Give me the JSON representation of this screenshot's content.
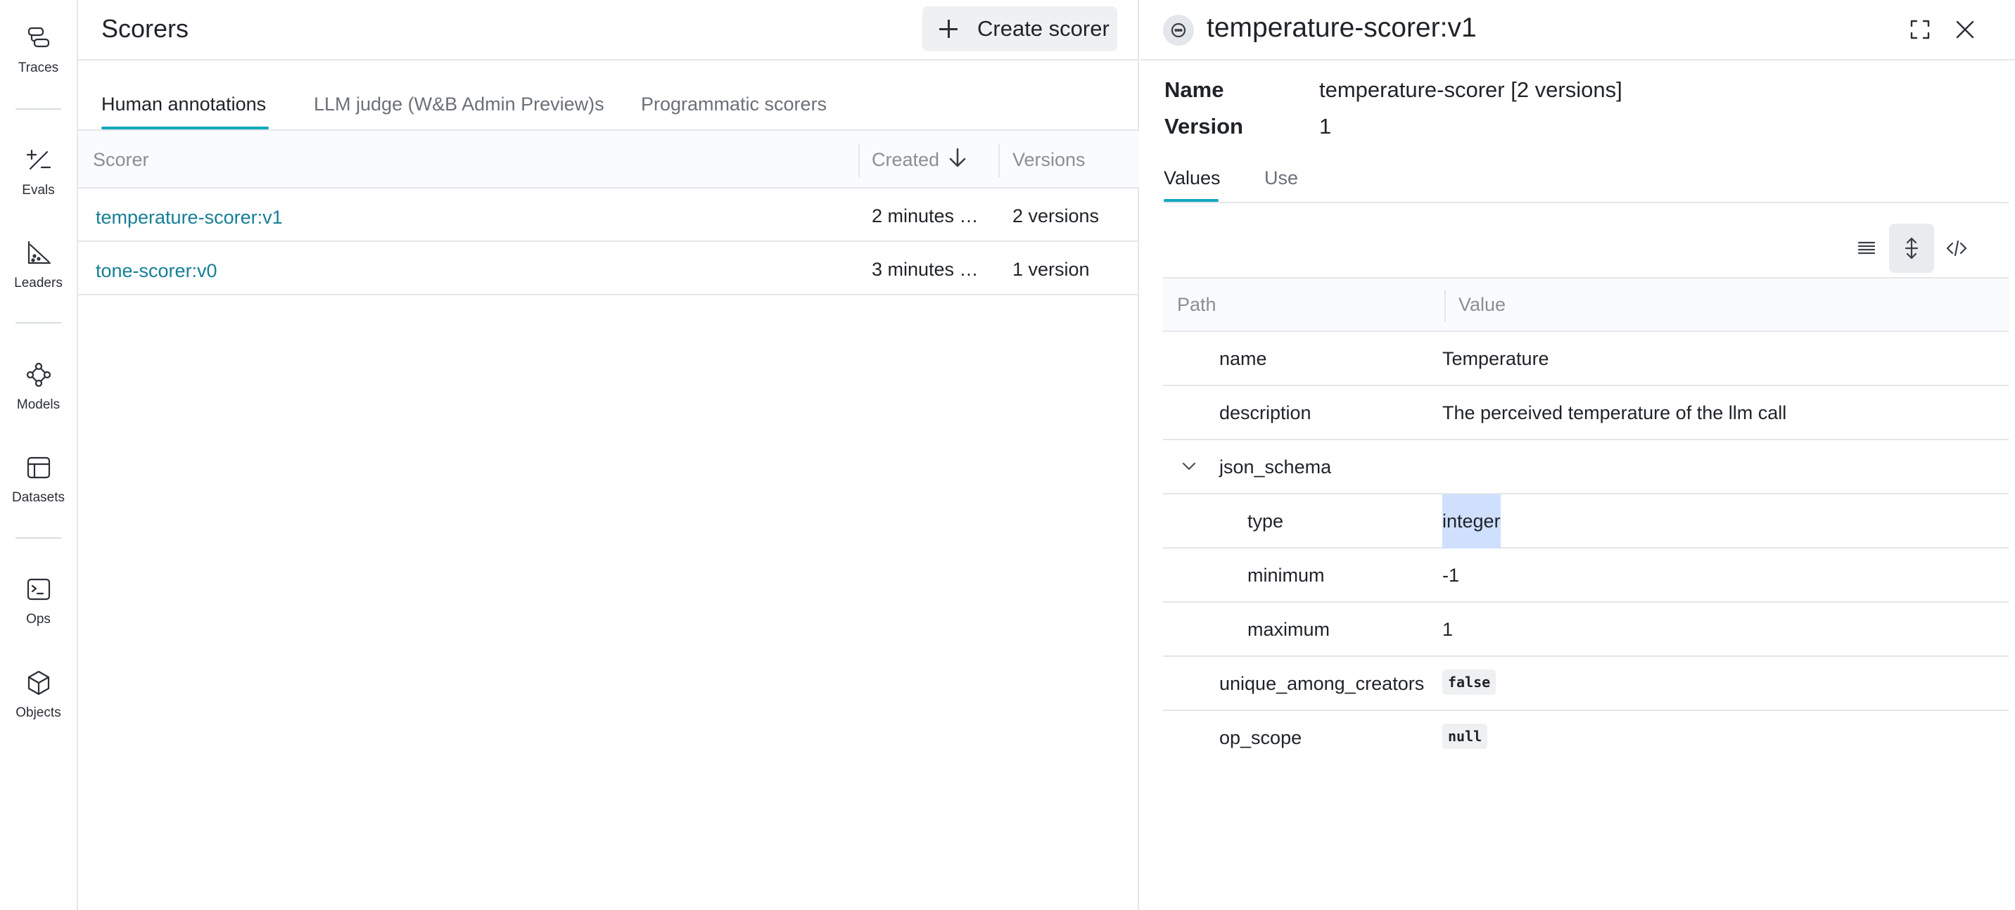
{
  "nav": {
    "items": [
      {
        "label": "Traces",
        "icon": "traces-icon"
      },
      {
        "label": "Evals",
        "icon": "evals-icon"
      },
      {
        "label": "Leaders",
        "icon": "leaders-icon"
      },
      {
        "label": "Models",
        "icon": "models-icon"
      },
      {
        "label": "Datasets",
        "icon": "datasets-icon"
      },
      {
        "label": "Ops",
        "icon": "ops-icon"
      },
      {
        "label": "Objects",
        "icon": "objects-icon"
      }
    ]
  },
  "scorers": {
    "title": "Scorers",
    "create_label": "Create scorer",
    "tabs": [
      {
        "label": "Human annotations",
        "active": true
      },
      {
        "label": "LLM judge (W&B Admin Preview)s",
        "active": false
      },
      {
        "label": "Programmatic scorers",
        "active": false
      }
    ],
    "columns": {
      "scorer": "Scorer",
      "created": "Created",
      "versions": "Versions"
    },
    "rows": [
      {
        "scorer": "temperature-scorer:v1",
        "created": "2 minutes …",
        "versions": "2 versions"
      },
      {
        "scorer": "tone-scorer:v0",
        "created": "3 minutes …",
        "versions": "1 version"
      }
    ]
  },
  "detail": {
    "title": "temperature-scorer:v1",
    "name_key": "Name",
    "name_value": "temperature-scorer [2 versions]",
    "version_key": "Version",
    "version_value": "1",
    "tabs": [
      {
        "label": "Values",
        "active": true
      },
      {
        "label": "Use",
        "active": false
      }
    ],
    "columns": {
      "path": "Path",
      "value": "Value"
    },
    "rows": [
      {
        "path": "name",
        "value": "Temperature"
      },
      {
        "path": "description",
        "value": "The perceived temperature of the llm call"
      },
      {
        "path": "json_schema",
        "value": ""
      },
      {
        "path": "type",
        "value": "integer"
      },
      {
        "path": "minimum",
        "value": "-1"
      },
      {
        "path": "maximum",
        "value": "1"
      },
      {
        "path": "unique_among_creators",
        "value": "false"
      },
      {
        "path": "op_scope",
        "value": "null"
      }
    ]
  },
  "colors": {
    "accent": "#13a9ba",
    "link": "#167f96",
    "selection": "#cfe0ff"
  }
}
